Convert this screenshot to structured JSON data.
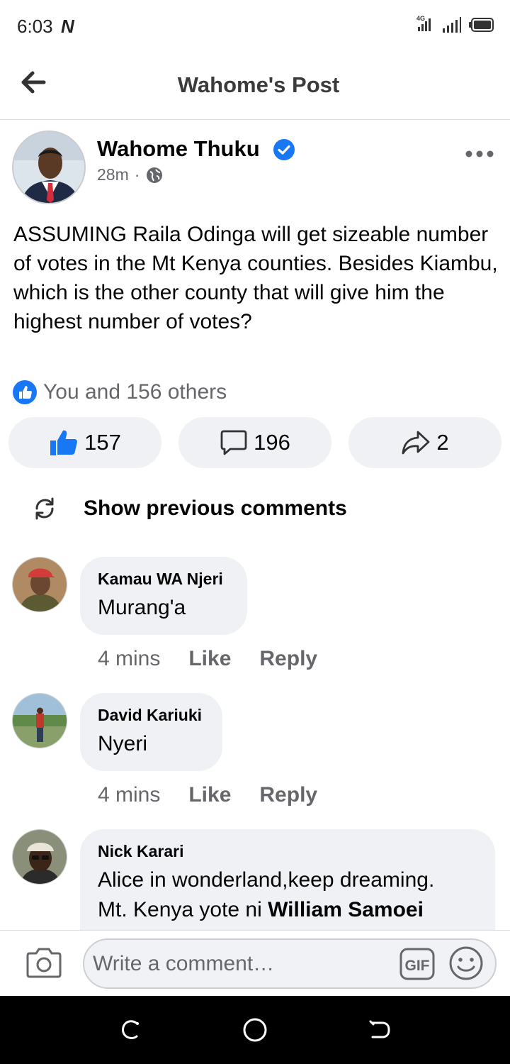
{
  "status_bar": {
    "time": "6:03",
    "network": "4G"
  },
  "header": {
    "title": "Wahome's Post"
  },
  "post": {
    "author": "Wahome Thuku",
    "time": "28m",
    "text": "ASSUMING Raila Odinga will get sizeable number of votes in the Mt Kenya counties. Besides Kiambu, which is the other county that will give him the highest number of votes?",
    "reactions_summary": "You and 156 others",
    "like_count": "157",
    "comment_count": "196",
    "share_count": "2"
  },
  "show_previous": {
    "label": "Show previous comments"
  },
  "comments": [
    {
      "name": "Kamau WA Njeri",
      "text": "Murang'a",
      "time": "4 mins",
      "like": "Like",
      "reply": "Reply"
    },
    {
      "name": "David Kariuki",
      "text": "Nyeri",
      "time": "4 mins",
      "like": "Like",
      "reply": "Reply"
    },
    {
      "name": "Nick Karari",
      "text_line1": "Alice in wonderland,keep dreaming.",
      "text_line2_plain": "Mt. Kenya yote ni ",
      "text_line2_bold": "William Samoei"
    }
  ],
  "composer": {
    "placeholder": "Write a comment…",
    "gif_label": "GIF"
  },
  "colors": {
    "accent": "#1877f2",
    "bubble": "#eff1f4",
    "muted": "#65676b"
  },
  "icons": [
    "back-arrow-icon",
    "verified-icon",
    "globe-icon",
    "more-icon",
    "like-reaction-icon",
    "thumbs-up-icon",
    "comment-icon",
    "share-icon",
    "refresh-icon",
    "camera-icon",
    "gif-icon",
    "emoji-icon"
  ]
}
